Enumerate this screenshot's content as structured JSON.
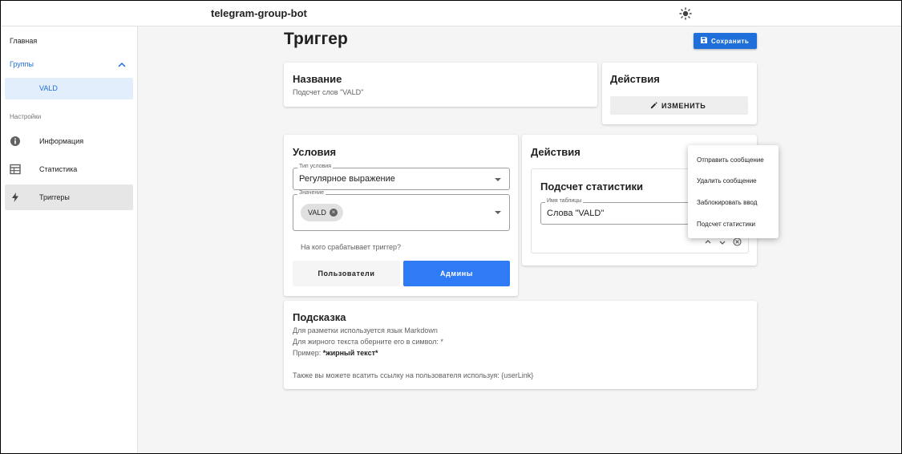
{
  "app": {
    "title": "telegram-group-bot"
  },
  "sidebar": {
    "home": "Главная",
    "groups": "Группы",
    "group_item": "VALD",
    "settings_section": "Настройки",
    "info": "Информация",
    "stats": "Статистика",
    "triggers": "Триггеры"
  },
  "page": {
    "title": "Триггер",
    "save_label": "Сохранить"
  },
  "name_card": {
    "heading": "Название",
    "value": "Подсчет слов \"VALD\""
  },
  "actions_top": {
    "heading": "Действия",
    "edit_label": "ИЗМЕНИТЬ"
  },
  "conditions": {
    "heading": "Условия",
    "type_label": "Тип условия",
    "type_value": "Регулярное выражение",
    "value_label": "Значение",
    "chip": "VALD",
    "trigger_for": "На кого срабатывает триггер?",
    "users_btn": "Пользователи",
    "admins_btn": "Админы"
  },
  "actions": {
    "heading": "Действия",
    "stat_title": "Подсчет статистики",
    "table_label": "Имя таблицы",
    "table_value": "Слова \"VALD\""
  },
  "menu": {
    "items": [
      "Отправить сообщение",
      "Удалить сообщение",
      "Заблокировать ввод",
      "Подсчет статистики"
    ]
  },
  "hint": {
    "heading": "Подсказка",
    "line1": "Для разметки используется язык Markdown",
    "line2": "Для жирного текста оберните его в символ: *",
    "line3_prefix": "Пример: ",
    "line3_bold": "*жирный текст*",
    "line4": "Также вы можете всатить ссылку на пользователя используя: {userLink}"
  },
  "colors": {
    "accent": "#1e6fd9",
    "button_blue": "#2f7bf6",
    "selected_bg": "#e3eefc"
  }
}
